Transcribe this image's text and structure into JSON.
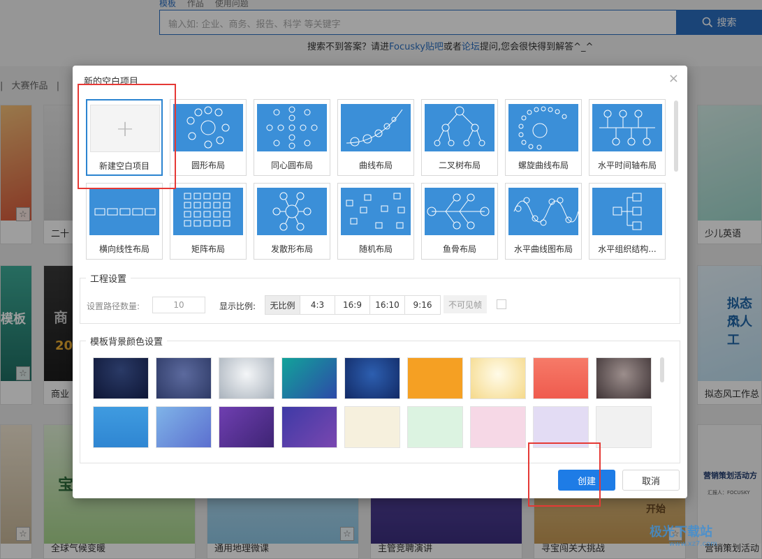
{
  "background": {
    "tabs": [
      "模板",
      "作品",
      "使用问题"
    ],
    "search_placeholder": "输入如: 企业、商务、报告、科学 等关键字",
    "search_button": "搜索",
    "help_prefix": "搜索不到答案？请进",
    "help_link1": "Focusky贴吧",
    "help_mid": "或者",
    "help_link2": "论坛",
    "help_suffix": "提问,您会很快得到解答^_^",
    "categories": [
      "|",
      "大赛作品",
      "|"
    ],
    "cards": [
      {
        "caption": "",
        "star": "☆"
      },
      {
        "caption": "二十",
        "star": "☆"
      },
      {
        "caption": "少儿英语",
        "star": "☆"
      },
      {
        "caption": "",
        "star": "☆"
      },
      {
        "caption": "商业",
        "star": "☆"
      },
      {
        "caption": "拟态风工作总",
        "star": "☆"
      },
      {
        "caption": "",
        "star": "☆"
      },
      {
        "caption": "全球气候变暖",
        "star": "☆"
      },
      {
        "caption": "通用地理微课",
        "star": "☆"
      },
      {
        "caption": "主管竞聘演讲",
        "star": "☆"
      },
      {
        "caption": "寻宝闯关大挑战",
        "star": "☆"
      },
      {
        "caption": "营销策划活动",
        "star": "☆"
      }
    ],
    "card_texts": {
      "mobanb": "模板",
      "shang": "商",
      "twenty": "20",
      "nitai": "拟态风",
      "gongzuo": "个人工",
      "yingxiao": "营销策划活动方",
      "focusky": "汇报人：FOCUSKY",
      "bao": "宝",
      "kai": "开始"
    },
    "watermark": "极光下载站",
    "watermark_url": "www.xz7.com"
  },
  "dialog": {
    "title": "新的空白项目",
    "close_icon": "×",
    "templates": [
      {
        "label": "新建空白项目",
        "icon": "plus-icon",
        "selected": true
      },
      {
        "label": "圆形布局",
        "icon": "circle-layout-icon"
      },
      {
        "label": "同心圆布局",
        "icon": "concentric-layout-icon"
      },
      {
        "label": "曲线布局",
        "icon": "curve-layout-icon"
      },
      {
        "label": "二叉树布局",
        "icon": "binary-tree-icon"
      },
      {
        "label": "螺旋曲线布局",
        "icon": "spiral-layout-icon"
      },
      {
        "label": "水平时间轴布局",
        "icon": "timeline-layout-icon"
      },
      {
        "label": "横向线性布局",
        "icon": "linear-layout-icon"
      },
      {
        "label": "矩阵布局",
        "icon": "matrix-layout-icon"
      },
      {
        "label": "发散形布局",
        "icon": "radial-layout-icon"
      },
      {
        "label": "随机布局",
        "icon": "random-layout-icon"
      },
      {
        "label": "鱼骨布局",
        "icon": "fishbone-layout-icon"
      },
      {
        "label": "水平曲线图布局",
        "icon": "wave-layout-icon"
      },
      {
        "label": "水平组织结构...",
        "icon": "org-chart-icon"
      }
    ],
    "project_settings": {
      "title": "工程设置",
      "path_count_label": "设置路径数量:",
      "path_count_value": "10",
      "ratio_label": "显示比例:",
      "ratios": [
        "无比例",
        "4:3",
        "16:9",
        "16:10",
        "9:16"
      ],
      "active_ratio": "无比例",
      "invisible_frame": "不可见帧",
      "invisible_checked": false
    },
    "bg_color_settings": {
      "title": "模板背景颜色设置",
      "swatches": [
        {
          "name": "dark-navy",
          "style": "radial-gradient(circle at 50% 30%, #2a3a66, #0e1636)"
        },
        {
          "name": "slate-blue",
          "style": "radial-gradient(circle at 50% 40%, #5c6a9e, #2e3a66)"
        },
        {
          "name": "silver",
          "style": "radial-gradient(circle at 50% 40%, #f4f6f8, #a9b2bc)"
        },
        {
          "name": "teal-blue",
          "style": "linear-gradient(135deg, #12a39a, #2d4aa8)"
        },
        {
          "name": "royal-blue",
          "style": "radial-gradient(circle at 50% 40%, #2d5fb0, #122a66)"
        },
        {
          "name": "orange",
          "style": "#f5a023"
        },
        {
          "name": "cream",
          "style": "radial-gradient(circle at 50% 40%, #fffbe8, #f5d98a)"
        },
        {
          "name": "coral",
          "style": "linear-gradient(180deg, #f67a68, #ef5b4e)"
        },
        {
          "name": "mocha",
          "style": "radial-gradient(circle at 50% 40%, #9c8e8c, #3f3436)"
        },
        {
          "name": "sky-blue",
          "style": "linear-gradient(180deg, #3f9be0, #2f86d2)"
        },
        {
          "name": "periwinkle",
          "style": "linear-gradient(135deg, #7fb4e8, #5c6fcf)"
        },
        {
          "name": "purple",
          "style": "linear-gradient(135deg, #6f3fb1, #3e2474)"
        },
        {
          "name": "violet",
          "style": "linear-gradient(135deg, #3e3aa6, #7a47b0)"
        },
        {
          "name": "beige",
          "style": "#f6f0dd"
        },
        {
          "name": "mint",
          "style": "#dcf3e1"
        },
        {
          "name": "pink",
          "style": "#f6d8e6"
        },
        {
          "name": "lavender",
          "style": "#e3dcf4"
        },
        {
          "name": "light-gray",
          "style": "#f1f1f1"
        }
      ]
    },
    "buttons": {
      "create": "创建",
      "cancel": "取消"
    }
  }
}
